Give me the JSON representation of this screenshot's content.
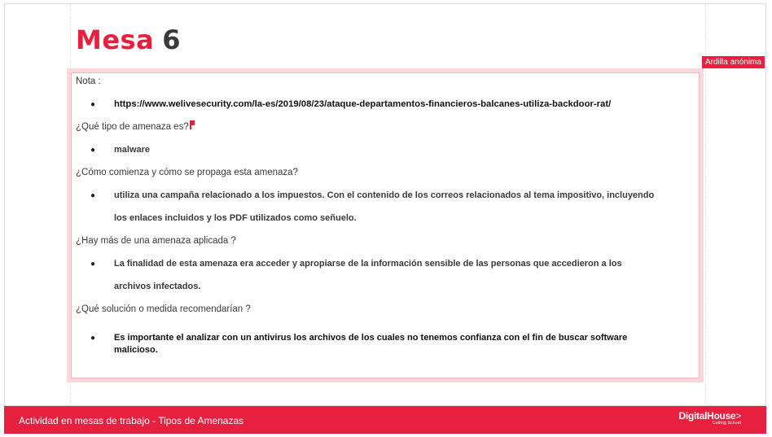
{
  "slide": {
    "title_word": "Mesa",
    "title_number": "6",
    "cursor_label": "Ardilla anónima",
    "note_label": "Nota :",
    "items": [
      {
        "question": "",
        "answer": "https://www.welivesecurity.com/la-es/2019/08/23/ataque-departamentos-financieros-balcanes-utiliza-backdoor-rat/"
      },
      {
        "question": "¿Qué tipo de amenaza es?",
        "answer": "malware"
      },
      {
        "question": "¿Cómo comienza y cómo se propaga esta amenaza?",
        "answer_line1": "utiliza una campaña  relacionado a los impuestos. Con el contenido de los correos relacionados al tema impositivo, incluyendo",
        "answer_line2": "los enlaces incluidos y los PDF utilizados como señuelo."
      },
      {
        "question": "¿Hay más de una amenaza aplicada ?",
        "answer_line1": "La finalidad de esta amenaza era acceder y apropiarse de la información sensible de las personas que accedieron a los",
        "answer_line2": "archivos infectados."
      },
      {
        "question": "¿Qué solución o medida recomendarían ?",
        "answer_line1": "Es importante el analizar con un antivirus los archivos de los cuales no tenemos confianza con el fin de buscar software",
        "answer_line2": "malicioso."
      }
    ]
  },
  "footer": {
    "text": "Actividad en mesas de trabajo - Tipos de Amenazas",
    "logo_main": "DigitalHouse",
    "logo_arrow": ">",
    "logo_sub": "Coding School"
  },
  "colors": {
    "accent": "#e8203f",
    "frame": "#f9d7dc"
  }
}
